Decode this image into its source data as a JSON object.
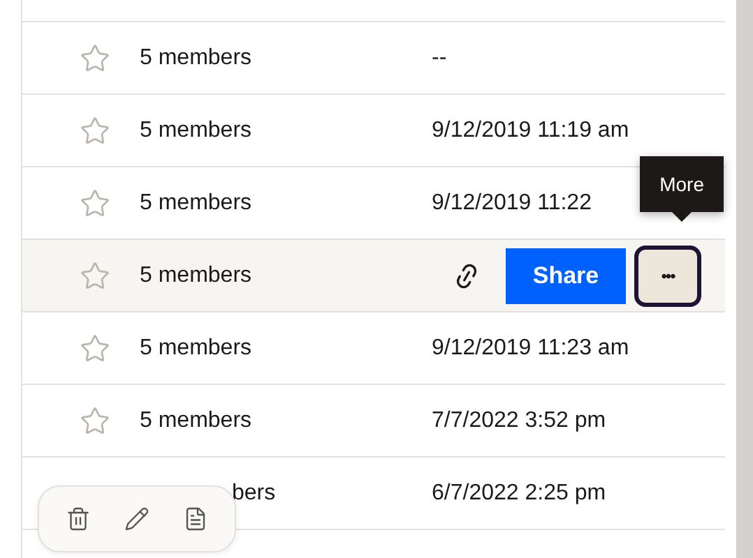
{
  "rows": [
    {
      "kind": "plain",
      "members": "5 members",
      "modified": "--"
    },
    {
      "kind": "plain",
      "members": "5 members",
      "modified": "9/12/2019 11:19 am"
    },
    {
      "kind": "plain",
      "members": "5 members",
      "modified": "9/12/2019 11:22"
    },
    {
      "kind": "hovered",
      "members": "5 members",
      "share": "Share",
      "more": "•••",
      "tooltip": "More"
    },
    {
      "kind": "plain",
      "members": "5 members",
      "modified": "9/12/2019 11:23 am"
    },
    {
      "kind": "plain",
      "members": "5 members",
      "modified": "7/7/2022 3:52 pm"
    },
    {
      "kind": "covered",
      "members": "bers",
      "modified": "6/7/2022 2:25 pm"
    },
    {
      "kind": "empty"
    }
  ]
}
